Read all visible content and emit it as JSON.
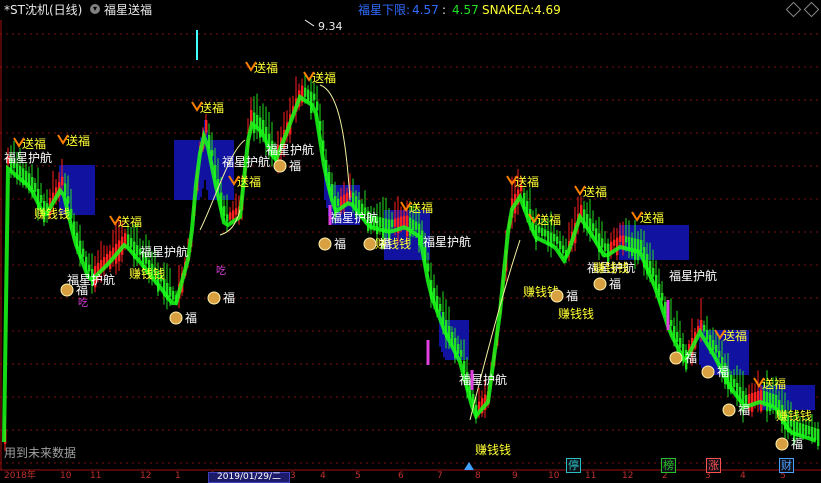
{
  "header": {
    "stock_title": "*ST沈机(日线)",
    "indicator_name": "福星送福",
    "field1_label": "福星下限:",
    "field1_value": "4.57",
    "field2_label": ":",
    "field2_value": "4.57",
    "field3_label": "SNAKEA:",
    "field3_value": "4.69",
    "peak_label": "9.34"
  },
  "labels": {
    "send": "送福",
    "guard": "福星护航",
    "earn": "赚钱钱",
    "fu": "福",
    "eat": "吃"
  },
  "future_data_text": "用到未来数据",
  "x_axis": {
    "date_cursor": "2019/01/29/二",
    "ticks": [
      "2018年",
      "10",
      "11",
      "12",
      "1",
      "2",
      "3",
      "4",
      "5",
      "6",
      "7",
      "8",
      "9",
      "10",
      "11",
      "12",
      "2",
      "3",
      "4",
      "5"
    ]
  },
  "bottom_tags": [
    {
      "text": "停",
      "color": "#27c0c0"
    },
    {
      "text": "榜",
      "color": "#27c027"
    },
    {
      "text": "涨",
      "color": "#ff5050"
    },
    {
      "text": "财",
      "color": "#4aa0ff"
    }
  ],
  "colors": {
    "rise": "#ff2020",
    "fall": "#21e021",
    "band": "#1212a0",
    "grid": "#7a1010",
    "text_yellow": "#ffff33",
    "text_white": "#ffffff",
    "magenta": "#e040e0"
  }
}
